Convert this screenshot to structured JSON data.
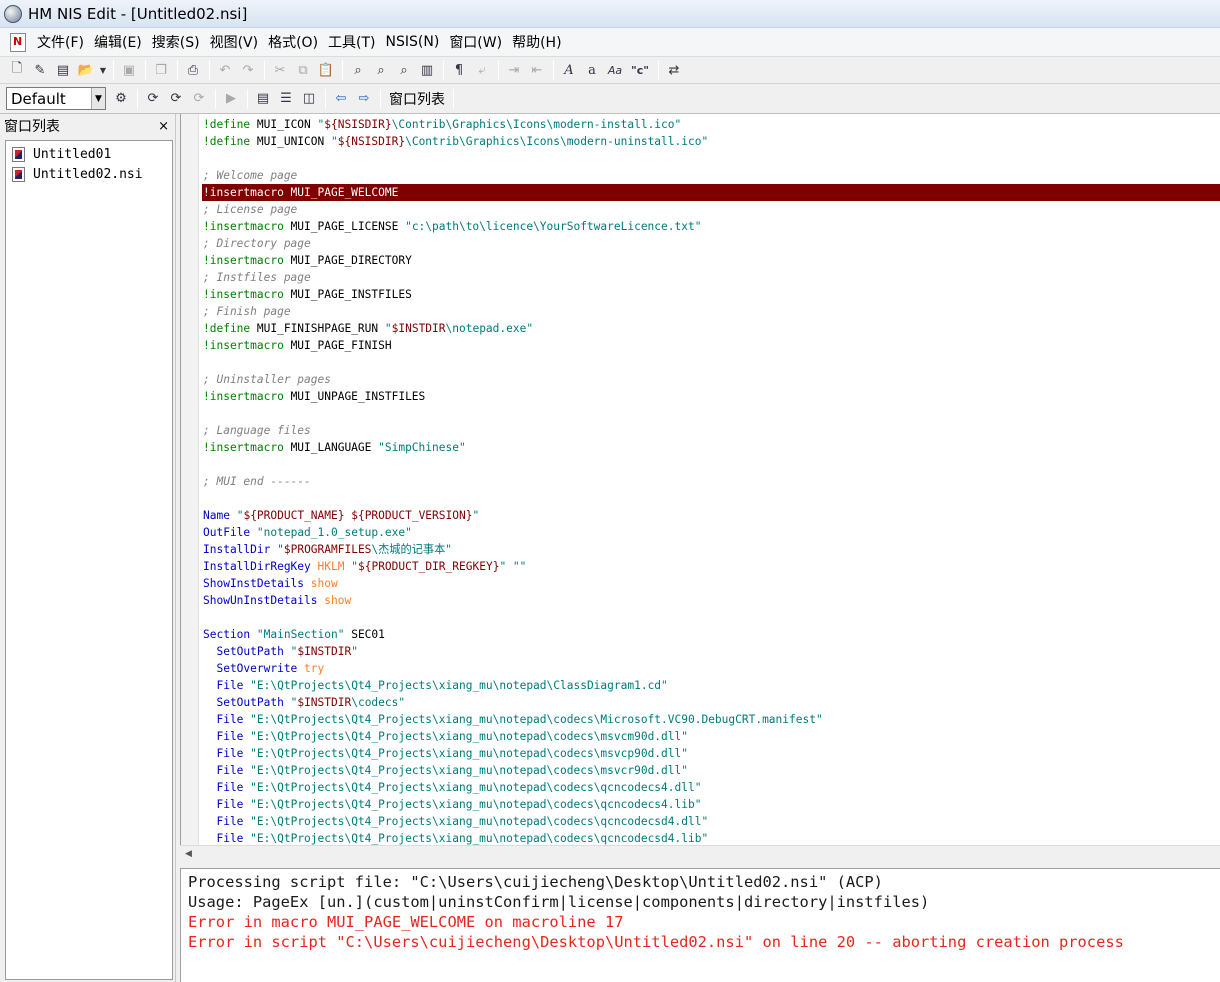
{
  "window": {
    "title": "HM NIS Edit - [Untitled02.nsi]"
  },
  "menu": [
    "文件(F)",
    "编辑(E)",
    "搜索(S)",
    "视图(V)",
    "格式(O)",
    "工具(T)",
    "NSIS(N)",
    "窗口(W)",
    "帮助(H)"
  ],
  "toolbar": {
    "combo_value": "Default",
    "window_list_label": "窗口列表",
    "format_c_label": "\"c\""
  },
  "side_panel": {
    "title": "窗口列表",
    "close": "×",
    "files": [
      "Untitled01",
      "Untitled02.nsi"
    ]
  },
  "colors": {
    "directive": "#008000",
    "comment": "#808080",
    "string": "#007a7a",
    "variable": "#800000",
    "keyword": "#0000c8",
    "option": "#ff7f27",
    "highlight_bg": "#800000"
  },
  "code_lines": [
    {
      "highlight": false,
      "tokens": [
        {
          "t": "!define",
          "c": "directive"
        },
        {
          "t": " MUI_ICON ",
          "c": "plain"
        },
        {
          "t": "\"",
          "c": "string"
        },
        {
          "t": "${NSISDIR}",
          "c": "variable"
        },
        {
          "t": "\\Contrib\\Graphics\\Icons\\modern-install.ico\"",
          "c": "string"
        }
      ]
    },
    {
      "highlight": false,
      "tokens": [
        {
          "t": "!define",
          "c": "directive"
        },
        {
          "t": " MUI_UNICON ",
          "c": "plain"
        },
        {
          "t": "\"",
          "c": "string"
        },
        {
          "t": "${NSISDIR}",
          "c": "variable"
        },
        {
          "t": "\\Contrib\\Graphics\\Icons\\modern-uninstall.ico\"",
          "c": "string"
        }
      ]
    },
    {
      "highlight": false,
      "tokens": []
    },
    {
      "highlight": false,
      "tokens": [
        {
          "t": "; Welcome page",
          "c": "comment"
        }
      ]
    },
    {
      "highlight": true,
      "tokens": [
        {
          "t": "!insertmacro MUI_PAGE_WELCOME",
          "c": "plain"
        }
      ]
    },
    {
      "highlight": false,
      "tokens": [
        {
          "t": "; License page",
          "c": "comment"
        }
      ]
    },
    {
      "highlight": false,
      "tokens": [
        {
          "t": "!insertmacro",
          "c": "directive"
        },
        {
          "t": " MUI_PAGE_LICENSE ",
          "c": "plain"
        },
        {
          "t": "\"c:\\path\\to\\licence\\YourSoftwareLicence.txt\"",
          "c": "string"
        }
      ]
    },
    {
      "highlight": false,
      "tokens": [
        {
          "t": "; Directory page",
          "c": "comment"
        }
      ]
    },
    {
      "highlight": false,
      "tokens": [
        {
          "t": "!insertmacro",
          "c": "directive"
        },
        {
          "t": " MUI_PAGE_DIRECTORY",
          "c": "plain"
        }
      ]
    },
    {
      "highlight": false,
      "tokens": [
        {
          "t": "; Instfiles page",
          "c": "comment"
        }
      ]
    },
    {
      "highlight": false,
      "tokens": [
        {
          "t": "!insertmacro",
          "c": "directive"
        },
        {
          "t": " MUI_PAGE_INSTFILES",
          "c": "plain"
        }
      ]
    },
    {
      "highlight": false,
      "tokens": [
        {
          "t": "; Finish page",
          "c": "comment"
        }
      ]
    },
    {
      "highlight": false,
      "tokens": [
        {
          "t": "!define",
          "c": "directive"
        },
        {
          "t": " MUI_FINISHPAGE_RUN ",
          "c": "plain"
        },
        {
          "t": "\"",
          "c": "string"
        },
        {
          "t": "$INSTDIR",
          "c": "variable"
        },
        {
          "t": "\\notepad.exe\"",
          "c": "string"
        }
      ]
    },
    {
      "highlight": false,
      "tokens": [
        {
          "t": "!insertmacro",
          "c": "directive"
        },
        {
          "t": " MUI_PAGE_FINISH",
          "c": "plain"
        }
      ]
    },
    {
      "highlight": false,
      "tokens": []
    },
    {
      "highlight": false,
      "tokens": [
        {
          "t": "; Uninstaller pages",
          "c": "comment"
        }
      ]
    },
    {
      "highlight": false,
      "tokens": [
        {
          "t": "!insertmacro",
          "c": "directive"
        },
        {
          "t": " MUI_UNPAGE_INSTFILES",
          "c": "plain"
        }
      ]
    },
    {
      "highlight": false,
      "tokens": []
    },
    {
      "highlight": false,
      "tokens": [
        {
          "t": "; Language files",
          "c": "comment"
        }
      ]
    },
    {
      "highlight": false,
      "tokens": [
        {
          "t": "!insertmacro",
          "c": "directive"
        },
        {
          "t": " MUI_LANGUAGE ",
          "c": "plain"
        },
        {
          "t": "\"SimpChinese\"",
          "c": "string"
        }
      ]
    },
    {
      "highlight": false,
      "tokens": []
    },
    {
      "highlight": false,
      "tokens": [
        {
          "t": "; MUI end ------",
          "c": "comment"
        }
      ]
    },
    {
      "highlight": false,
      "tokens": []
    },
    {
      "highlight": false,
      "tokens": [
        {
          "t": "Name",
          "c": "keyword"
        },
        {
          "t": " ",
          "c": "plain"
        },
        {
          "t": "\"",
          "c": "string"
        },
        {
          "t": "${PRODUCT_NAME} ${PRODUCT_VERSION}",
          "c": "variable"
        },
        {
          "t": "\"",
          "c": "string"
        }
      ]
    },
    {
      "highlight": false,
      "tokens": [
        {
          "t": "OutFile",
          "c": "keyword"
        },
        {
          "t": " ",
          "c": "plain"
        },
        {
          "t": "\"notepad_1.0_setup.exe\"",
          "c": "string"
        }
      ]
    },
    {
      "highlight": false,
      "tokens": [
        {
          "t": "InstallDir",
          "c": "keyword"
        },
        {
          "t": " ",
          "c": "plain"
        },
        {
          "t": "\"",
          "c": "string"
        },
        {
          "t": "$PROGRAMFILES",
          "c": "variable"
        },
        {
          "t": "\\杰城的记事本\"",
          "c": "string"
        }
      ]
    },
    {
      "highlight": false,
      "tokens": [
        {
          "t": "InstallDirRegKey",
          "c": "keyword"
        },
        {
          "t": " ",
          "c": "plain"
        },
        {
          "t": "HKLM",
          "c": "option"
        },
        {
          "t": " ",
          "c": "plain"
        },
        {
          "t": "\"",
          "c": "string"
        },
        {
          "t": "${PRODUCT_DIR_REGKEY}",
          "c": "variable"
        },
        {
          "t": "\" \"\"",
          "c": "string"
        }
      ]
    },
    {
      "highlight": false,
      "tokens": [
        {
          "t": "ShowInstDetails",
          "c": "keyword"
        },
        {
          "t": " ",
          "c": "plain"
        },
        {
          "t": "show",
          "c": "option"
        }
      ]
    },
    {
      "highlight": false,
      "tokens": [
        {
          "t": "ShowUnInstDetails",
          "c": "keyword"
        },
        {
          "t": " ",
          "c": "plain"
        },
        {
          "t": "show",
          "c": "option"
        }
      ]
    },
    {
      "highlight": false,
      "tokens": []
    },
    {
      "highlight": false,
      "tokens": [
        {
          "t": "Section",
          "c": "keyword"
        },
        {
          "t": " ",
          "c": "plain"
        },
        {
          "t": "\"MainSection\"",
          "c": "string"
        },
        {
          "t": " SEC01",
          "c": "plain"
        }
      ]
    },
    {
      "highlight": false,
      "tokens": [
        {
          "t": "  SetOutPath",
          "c": "keyword"
        },
        {
          "t": " ",
          "c": "plain"
        },
        {
          "t": "\"",
          "c": "string"
        },
        {
          "t": "$INSTDIR",
          "c": "variable"
        },
        {
          "t": "\"",
          "c": "string"
        }
      ]
    },
    {
      "highlight": false,
      "tokens": [
        {
          "t": "  SetOverwrite",
          "c": "keyword"
        },
        {
          "t": " ",
          "c": "plain"
        },
        {
          "t": "try",
          "c": "option"
        }
      ]
    },
    {
      "highlight": false,
      "tokens": [
        {
          "t": "  File",
          "c": "keyword"
        },
        {
          "t": " ",
          "c": "plain"
        },
        {
          "t": "\"E:\\QtProjects\\Qt4_Projects\\xiang_mu\\notepad\\ClassDiagram1.cd\"",
          "c": "string"
        }
      ]
    },
    {
      "highlight": false,
      "tokens": [
        {
          "t": "  SetOutPath",
          "c": "keyword"
        },
        {
          "t": " ",
          "c": "plain"
        },
        {
          "t": "\"",
          "c": "string"
        },
        {
          "t": "$INSTDIR",
          "c": "variable"
        },
        {
          "t": "\\codecs\"",
          "c": "string"
        }
      ]
    },
    {
      "highlight": false,
      "tokens": [
        {
          "t": "  File",
          "c": "keyword"
        },
        {
          "t": " ",
          "c": "plain"
        },
        {
          "t": "\"E:\\QtProjects\\Qt4_Projects\\xiang_mu\\notepad\\codecs\\Microsoft.VC90.DebugCRT.manifest\"",
          "c": "string"
        }
      ]
    },
    {
      "highlight": false,
      "tokens": [
        {
          "t": "  File",
          "c": "keyword"
        },
        {
          "t": " ",
          "c": "plain"
        },
        {
          "t": "\"E:\\QtProjects\\Qt4_Projects\\xiang_mu\\notepad\\codecs\\msvcm90d.dll\"",
          "c": "string"
        }
      ]
    },
    {
      "highlight": false,
      "tokens": [
        {
          "t": "  File",
          "c": "keyword"
        },
        {
          "t": " ",
          "c": "plain"
        },
        {
          "t": "\"E:\\QtProjects\\Qt4_Projects\\xiang_mu\\notepad\\codecs\\msvcp90d.dll\"",
          "c": "string"
        }
      ]
    },
    {
      "highlight": false,
      "tokens": [
        {
          "t": "  File",
          "c": "keyword"
        },
        {
          "t": " ",
          "c": "plain"
        },
        {
          "t": "\"E:\\QtProjects\\Qt4_Projects\\xiang_mu\\notepad\\codecs\\msvcr90d.dll\"",
          "c": "string"
        }
      ]
    },
    {
      "highlight": false,
      "tokens": [
        {
          "t": "  File",
          "c": "keyword"
        },
        {
          "t": " ",
          "c": "plain"
        },
        {
          "t": "\"E:\\QtProjects\\Qt4_Projects\\xiang_mu\\notepad\\codecs\\qcncodecs4.dll\"",
          "c": "string"
        }
      ]
    },
    {
      "highlight": false,
      "tokens": [
        {
          "t": "  File",
          "c": "keyword"
        },
        {
          "t": " ",
          "c": "plain"
        },
        {
          "t": "\"E:\\QtProjects\\Qt4_Projects\\xiang_mu\\notepad\\codecs\\qcncodecs4.lib\"",
          "c": "string"
        }
      ]
    },
    {
      "highlight": false,
      "tokens": [
        {
          "t": "  File",
          "c": "keyword"
        },
        {
          "t": " ",
          "c": "plain"
        },
        {
          "t": "\"E:\\QtProjects\\Qt4_Projects\\xiang_mu\\notepad\\codecs\\qcncodecsd4.dll\"",
          "c": "string"
        }
      ]
    },
    {
      "highlight": false,
      "tokens": [
        {
          "t": "  File",
          "c": "keyword"
        },
        {
          "t": " ",
          "c": "plain"
        },
        {
          "t": "\"E:\\QtProjects\\Qt4_Projects\\xiang_mu\\notepad\\codecs\\qcncodecsd4.lib\"",
          "c": "string"
        }
      ]
    }
  ],
  "output": [
    {
      "type": "normal",
      "text": "Processing script file: \"C:\\Users\\cuijiecheng\\Desktop\\Untitled02.nsi\" (ACP)"
    },
    {
      "type": "normal",
      "text": "Usage: PageEx [un.](custom|uninstConfirm|license|components|directory|instfiles)"
    },
    {
      "type": "error",
      "text": "Error in macro MUI_PAGE_WELCOME on macroline 17"
    },
    {
      "type": "error",
      "text": "Error in script \"C:\\Users\\cuijiecheng\\Desktop\\Untitled02.nsi\" on line 20 -- aborting creation process"
    }
  ]
}
